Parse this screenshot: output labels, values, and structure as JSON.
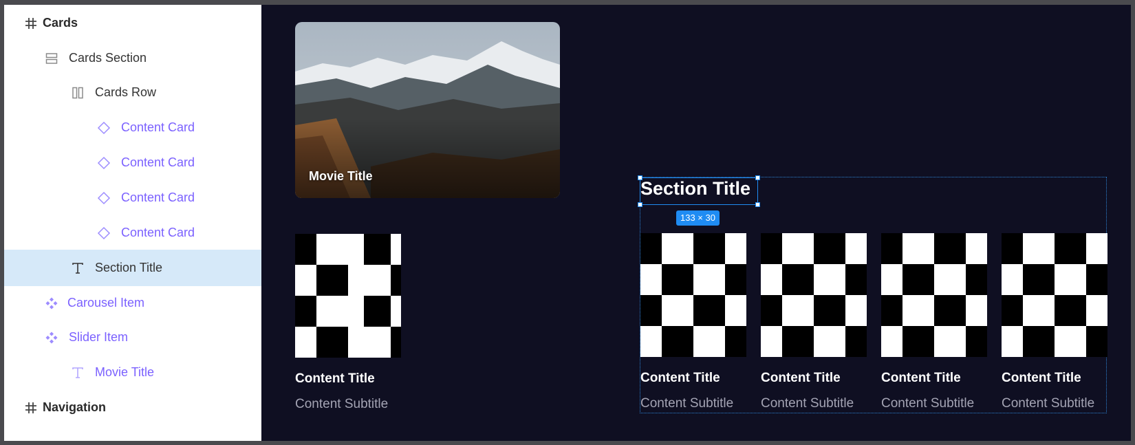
{
  "layers": [
    {
      "label": "Cards",
      "icon": "frame-hash-icon",
      "kind": "frame"
    },
    {
      "label": "Cards Section",
      "icon": "stack-layout-icon",
      "kind": "layout"
    },
    {
      "label": "Cards Row",
      "icon": "row-layout-icon",
      "kind": "layout"
    },
    {
      "label": "Content Card",
      "icon": "component-instance-icon",
      "kind": "component"
    },
    {
      "label": "Content Card",
      "icon": "component-instance-icon",
      "kind": "component"
    },
    {
      "label": "Content Card",
      "icon": "component-instance-icon",
      "kind": "component"
    },
    {
      "label": "Content Card",
      "icon": "component-instance-icon",
      "kind": "component"
    },
    {
      "label": "Section Title",
      "icon": "text-icon",
      "kind": "text",
      "selected": true
    },
    {
      "label": "Carousel Item",
      "icon": "component-main-icon",
      "kind": "component"
    },
    {
      "label": "Slider Item",
      "icon": "component-main-icon",
      "kind": "component"
    },
    {
      "label": "Movie Title",
      "icon": "text-icon",
      "kind": "component-text"
    },
    {
      "label": "Navigation",
      "icon": "frame-hash-icon",
      "kind": "frame"
    }
  ],
  "canvas": {
    "hero_card": {
      "title": "Movie Title"
    },
    "standalone_card": {
      "title": "Content Title",
      "subtitle": "Content Subtitle"
    },
    "section": {
      "title": "Section Title",
      "size_badge": "133 × 30",
      "cards": [
        {
          "title": "Content Title",
          "subtitle": "Content Subtitle"
        },
        {
          "title": "Content Title",
          "subtitle": "Content Subtitle"
        },
        {
          "title": "Content Title",
          "subtitle": "Content Subtitle"
        },
        {
          "title": "Content Title",
          "subtitle": "Content Subtitle"
        }
      ]
    }
  },
  "colors": {
    "canvas_bg": "#0f0f22",
    "selection": "#1f8cf3",
    "component": "#7b61ff",
    "selected_row": "#d6e9f9"
  }
}
